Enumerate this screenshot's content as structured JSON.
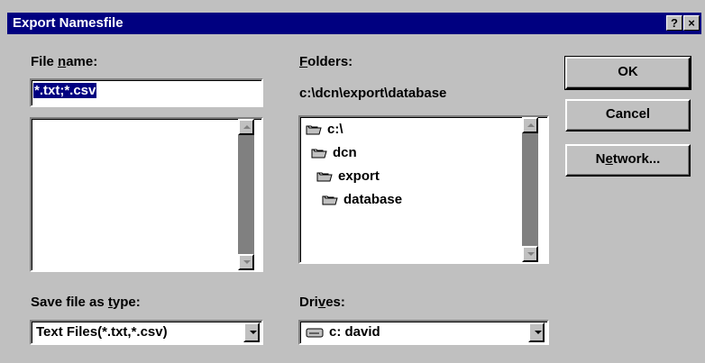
{
  "window": {
    "title": "Export Namesfile",
    "help_glyph": "?",
    "close_glyph": "×"
  },
  "file_name": {
    "label_pre": "File ",
    "label_accel": "n",
    "label_post": "ame:",
    "value": "*.txt;*.csv",
    "list_items": []
  },
  "folders": {
    "label_accel": "F",
    "label_post": "olders:",
    "current_path": "c:\\dcn\\export\\database",
    "items": [
      {
        "label": "c:\\",
        "icon": "open-folder-icon",
        "indent": 0
      },
      {
        "label": "dcn",
        "icon": "open-folder-icon",
        "indent": 1
      },
      {
        "label": "export",
        "icon": "open-folder-icon",
        "indent": 2
      },
      {
        "label": "database",
        "icon": "open-folder-icon",
        "indent": 3
      }
    ]
  },
  "buttons": {
    "ok": "OK",
    "cancel": "Cancel",
    "network_pre": "N",
    "network_accel": "e",
    "network_post": "twork..."
  },
  "save_type": {
    "label_pre": "Save file as ",
    "label_accel": "t",
    "label_post": "ype:",
    "value": "Text Files(*.txt,*.csv)"
  },
  "drives": {
    "label_pre": "Dri",
    "label_accel": "v",
    "label_post": "es:",
    "value": "c: david",
    "icon": "drive-icon"
  },
  "colors": {
    "titlebar": "#000080",
    "face": "#c0c0c0",
    "shadow": "#808080"
  }
}
